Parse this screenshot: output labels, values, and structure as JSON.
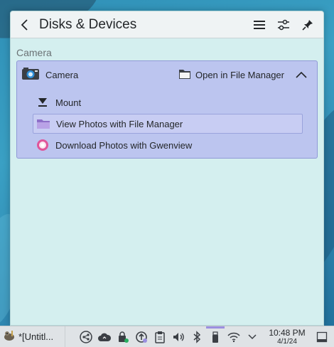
{
  "popup": {
    "title": "Disks & Devices",
    "icons": [
      "back-arrow-icon",
      "hamburger-menu-icon",
      "settings-sliders-icon",
      "pin-icon"
    ]
  },
  "section": {
    "title": "Camera"
  },
  "device": {
    "name": "Camera",
    "icon": "camera-icon",
    "open_label": "Open in File Manager",
    "actions": [
      {
        "label": "Mount",
        "icon": "eject-icon"
      },
      {
        "label": "View Photos with File Manager",
        "icon": "folder-icon",
        "selected": true
      },
      {
        "label": "Download Photos with Gwenview",
        "icon": "gwenview-icon"
      }
    ]
  },
  "taskbar": {
    "task_label": "*[Untitl...",
    "tray_icons": [
      "kde-connect-icon",
      "cloud-sync-icon",
      "vault-icon",
      "updates-icon",
      "clipboard-icon",
      "volume-icon",
      "bluetooth-icon",
      "disks-devices-icon",
      "wifi-icon",
      "expand-tray-icon"
    ],
    "time": "10:48 PM",
    "date": "4/1/24"
  },
  "colors": {
    "accent": "#9b8fe0",
    "card_bg": "#bcc5ef",
    "panel_bg": "#d4efef"
  }
}
